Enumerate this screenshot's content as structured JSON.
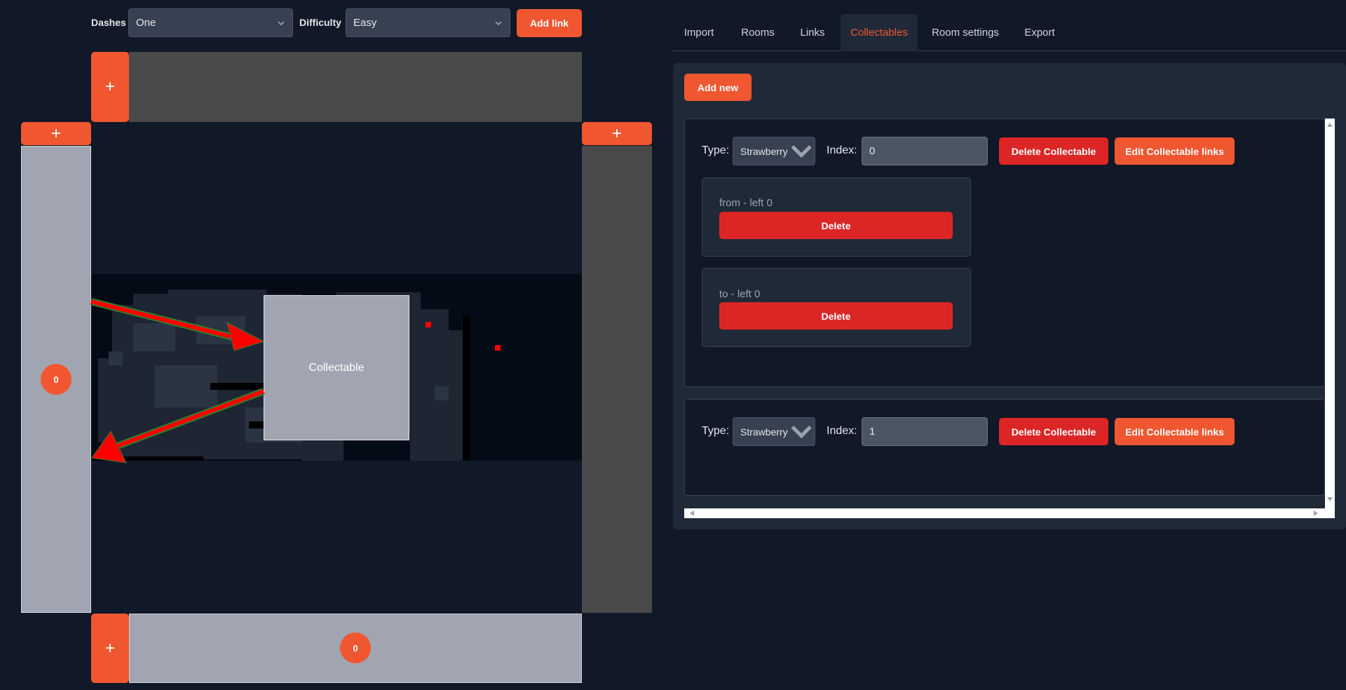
{
  "toolbar": {
    "dashes_label": "Dashes",
    "dashes_value": "One",
    "difficulty_label": "Difficulty",
    "difficulty_value": "Easy",
    "add_link_label": "Add link"
  },
  "editor": {
    "plus_symbol": "+",
    "left_badge": "0",
    "bottom_badge": "0",
    "collectable_label": "Collectable"
  },
  "tabs": [
    {
      "label": "Import",
      "active": false
    },
    {
      "label": "Rooms",
      "active": false
    },
    {
      "label": "Links",
      "active": false
    },
    {
      "label": "Collectables",
      "active": true
    },
    {
      "label": "Room settings",
      "active": false
    },
    {
      "label": "Export",
      "active": false
    }
  ],
  "collectables_panel": {
    "add_new_label": "Add new",
    "items": [
      {
        "type_label": "Type:",
        "type_value": "Strawberry",
        "index_label": "Index:",
        "index_value": "0",
        "delete_label": "Delete Collectable",
        "edit_links_label": "Edit Collectable links",
        "links": [
          {
            "text": "from - left 0",
            "delete_label": "Delete"
          },
          {
            "text": "to - left 0",
            "delete_label": "Delete"
          }
        ]
      },
      {
        "type_label": "Type:",
        "type_value": "Strawberry",
        "index_label": "Index:",
        "index_value": "1",
        "delete_label": "Delete Collectable",
        "edit_links_label": "Edit Collectable links",
        "links": []
      }
    ]
  },
  "colors": {
    "accent": "#f05731",
    "danger": "#dc2626",
    "background": "#111827",
    "panel": "#1f2937",
    "arrow": "#ff0000",
    "arrow_outline": "#2e7d32"
  }
}
